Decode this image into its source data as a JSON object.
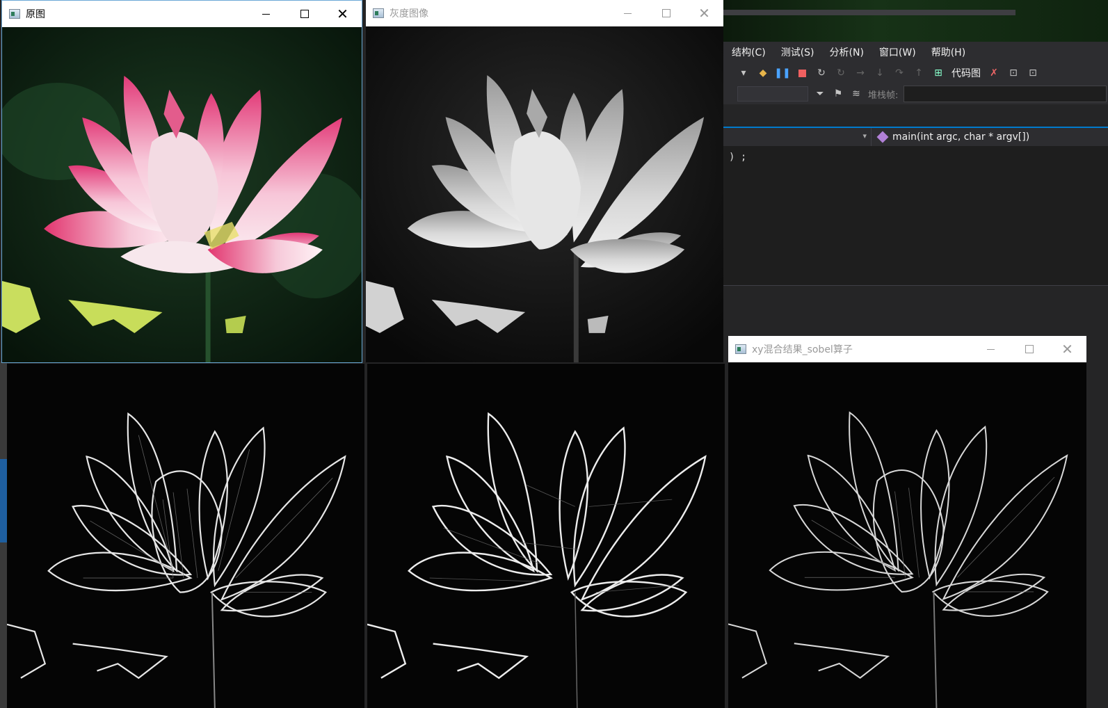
{
  "ide": {
    "menu": [
      "结构(C)",
      "测试(S)",
      "分析(N)",
      "窗口(W)",
      "帮助(H)"
    ],
    "toolbar_label": "代码图",
    "stack_label": "堆栈帧:",
    "function_signature": "main(int argc, char * argv[])",
    "code_fragment": ") ;"
  },
  "windows": {
    "original": {
      "title": "原图"
    },
    "gray": {
      "title": "灰度图像"
    },
    "sobel_xy": {
      "title": "xy混合结果_sobel算子"
    }
  },
  "colors": {
    "ide_accent": "#007acc",
    "lotus_pink": "#e23a78",
    "leaf_green": "#c8dd5a",
    "background_dark": "#0b170f"
  },
  "icons": [
    "restore-icon",
    "minimize-icon",
    "maximize-icon",
    "close-icon",
    "pause-icon",
    "stop-icon",
    "restart-icon",
    "filter-icon",
    "function-icon"
  ]
}
